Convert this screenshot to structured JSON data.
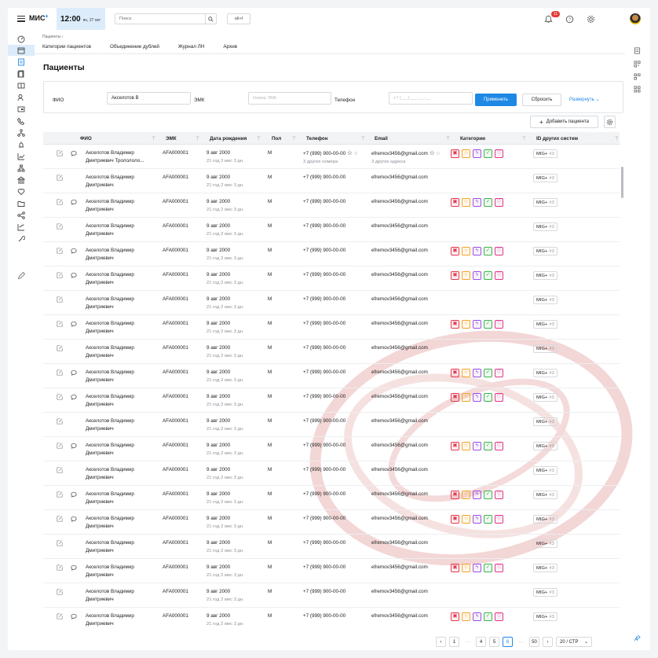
{
  "app": {
    "logo": "МИС",
    "logo_plus": "+",
    "time": "12:00",
    "date": "пн, 27 окт",
    "search_placeholder": "Поиск",
    "hotkey": "alt+f",
    "notifications_count": "11"
  },
  "breadcrumb": "Пациенты  ›",
  "tabs": [
    "Категории пациентов",
    "Объединение дублей",
    "Журнал ЛН",
    "Архив"
  ],
  "page_title": "Пациенты",
  "filters": {
    "fio_label": "ФИО",
    "fio_value": "Акселотов В",
    "emk_label": "ЭМК",
    "emk_placeholder": "Номер ЭМК",
    "phone_label": "Телефон",
    "phone_placeholder": "+7 (___) ___-__-__",
    "apply": "Применить",
    "reset": "Сбросить",
    "expand": "Развернуть"
  },
  "add_patient": "Добавить пациента",
  "columns": [
    "ФИО",
    "ЭМК",
    "Дата рождения",
    "Пол",
    "Телефон",
    "Email",
    "Категории",
    "ID других систем"
  ],
  "rows": [
    {
      "chat": true,
      "name1": "Акселотов Владимир",
      "name2": "Дмитриевич Тролололо...",
      "emk": "AFA000001",
      "dob": "9 авг 2000",
      "age": "21 год 2 мес 3 дн.",
      "sex": "М",
      "phone": "+7 (999) 900-00-00",
      "phone_sub": "3 других номера",
      "email": "efremov3456@gmail.com",
      "email_sub": "3 других адреса",
      "extra_icons": true,
      "cats": true,
      "mig": "MIG+",
      "mig_n": "#3"
    },
    {
      "chat": false,
      "name1": "Акселотов Владимир",
      "name2": "Дмитриевич",
      "emk": "AFA000001",
      "dob": "9 авг 2000",
      "age": "21 год 2 мес 3 дн.",
      "sex": "М",
      "phone": "+7 (999) 900-00-00",
      "phone_sub": "",
      "email": "efremov3456@gmail.com",
      "email_sub": "",
      "extra_icons": false,
      "cats": false,
      "mig": "MIG+",
      "mig_n": "#3"
    },
    {
      "chat": true,
      "name1": "Акселотов Владимир",
      "name2": "Дмитриевич",
      "emk": "AFA000001",
      "dob": "9 авг 2000",
      "age": "21 год 2 мес 3 дн.",
      "sex": "М",
      "phone": "+7 (999) 900-00-00",
      "phone_sub": "",
      "email": "efremov3456@gmail.com",
      "email_sub": "",
      "extra_icons": false,
      "cats": true,
      "mig": "MIG+",
      "mig_n": "#3"
    },
    {
      "chat": false,
      "name1": "Акселотов Владимир",
      "name2": "Дмитриевич",
      "emk": "AFA000001",
      "dob": "9 авг 2000",
      "age": "21 год 2 мес 3 дн.",
      "sex": "М",
      "phone": "+7 (999) 900-00-00",
      "phone_sub": "",
      "email": "efremov3456@gmail.com",
      "email_sub": "",
      "extra_icons": false,
      "cats": false,
      "mig": "MIG+",
      "mig_n": "#3"
    },
    {
      "chat": true,
      "name1": "Акселотов Владимир",
      "name2": "Дмитриевич",
      "emk": "AFA000001",
      "dob": "9 авг 2000",
      "age": "21 год 2 мес 3 дн.",
      "sex": "М",
      "phone": "+7 (999) 900-00-00",
      "phone_sub": "",
      "email": "efremov3456@gmail.com",
      "email_sub": "",
      "extra_icons": false,
      "cats": true,
      "mig": "MIG+",
      "mig_n": "#3"
    },
    {
      "chat": true,
      "name1": "Акселотов Владимир",
      "name2": "Дмитриевич",
      "emk": "AFA000001",
      "dob": "9 авг 2000",
      "age": "21 год 2 мес 3 дн.",
      "sex": "М",
      "phone": "+7 (999) 900-00-00",
      "phone_sub": "",
      "email": "efremov3456@gmail.com",
      "email_sub": "",
      "extra_icons": false,
      "cats": true,
      "mig": "MIG+",
      "mig_n": "#3"
    },
    {
      "chat": false,
      "name1": "Акселотов Владимир",
      "name2": "Дмитриевич",
      "emk": "AFA000001",
      "dob": "9 авг 2000",
      "age": "21 год 2 мес 3 дн.",
      "sex": "М",
      "phone": "+7 (999) 900-00-00",
      "phone_sub": "",
      "email": "efremov3456@gmail.com",
      "email_sub": "",
      "extra_icons": false,
      "cats": false,
      "mig": "MIG+",
      "mig_n": "#3"
    },
    {
      "chat": true,
      "name1": "Акселотов Владимир",
      "name2": "Дмитриевич",
      "emk": "AFA000001",
      "dob": "9 авг 2000",
      "age": "21 год 2 мес 3 дн.",
      "sex": "М",
      "phone": "+7 (999) 900-00-00",
      "phone_sub": "",
      "email": "efremov3456@gmail.com",
      "email_sub": "",
      "extra_icons": false,
      "cats": true,
      "mig": "MIG+",
      "mig_n": "#3"
    },
    {
      "chat": false,
      "name1": "Акселотов Владимир",
      "name2": "Дмитриевич",
      "emk": "AFA000001",
      "dob": "9 авг 2000",
      "age": "21 год 2 мес 3 дн.",
      "sex": "М",
      "phone": "+7 (999) 900-00-00",
      "phone_sub": "",
      "email": "efremov3456@gmail.com",
      "email_sub": "",
      "extra_icons": false,
      "cats": false,
      "mig": "MIG+",
      "mig_n": "#3"
    },
    {
      "chat": true,
      "name1": "Акселотов Владимир",
      "name2": "Дмитриевич",
      "emk": "AFA000001",
      "dob": "9 авг 2000",
      "age": "21 год 2 мес 3 дн.",
      "sex": "М",
      "phone": "+7 (999) 900-00-00",
      "phone_sub": "",
      "email": "efremov3456@gmail.com",
      "email_sub": "",
      "extra_icons": false,
      "cats": true,
      "mig": "MIG+",
      "mig_n": "#3"
    },
    {
      "chat": true,
      "name1": "Акселотов Владимир",
      "name2": "Дмитриевич",
      "emk": "AFA000001",
      "dob": "9 авг 2000",
      "age": "21 год 2 мес 3 дн.",
      "sex": "М",
      "phone": "+7 (999) 900-00-00",
      "phone_sub": "",
      "email": "efremov3456@gmail.com",
      "email_sub": "",
      "extra_icons": false,
      "cats": true,
      "mig": "MIG+",
      "mig_n": "#3"
    },
    {
      "chat": false,
      "name1": "Акселотов Владимир",
      "name2": "Дмитриевич",
      "emk": "AFA000001",
      "dob": "9 авг 2000",
      "age": "21 год 2 мес 3 дн.",
      "sex": "М",
      "phone": "+7 (999) 900-00-00",
      "phone_sub": "",
      "email": "efremov3456@gmail.com",
      "email_sub": "",
      "extra_icons": false,
      "cats": false,
      "mig": "MIG+",
      "mig_n": "#3"
    },
    {
      "chat": true,
      "name1": "Акселотов Владимир",
      "name2": "Дмитриевич",
      "emk": "AFA000001",
      "dob": "9 авг 2000",
      "age": "21 год 2 мес 3 дн.",
      "sex": "М",
      "phone": "+7 (999) 900-00-00",
      "phone_sub": "",
      "email": "efremov3456@gmail.com",
      "email_sub": "",
      "extra_icons": false,
      "cats": true,
      "mig": "MIG+",
      "mig_n": "#3"
    },
    {
      "chat": false,
      "name1": "Акселотов Владимир",
      "name2": "Дмитриевич",
      "emk": "AFA000001",
      "dob": "9 авг 2000",
      "age": "21 год 2 мес 3 дн.",
      "sex": "М",
      "phone": "+7 (999) 900-00-00",
      "phone_sub": "",
      "email": "efremov3456@gmail.com",
      "email_sub": "",
      "extra_icons": false,
      "cats": false,
      "mig": "MIG+",
      "mig_n": "#3"
    },
    {
      "chat": true,
      "name1": "Акселотов Владимир",
      "name2": "Дмитриевич",
      "emk": "AFA000001",
      "dob": "9 авг 2000",
      "age": "21 год 2 мес 3 дн.",
      "sex": "М",
      "phone": "+7 (999) 900-00-00",
      "phone_sub": "",
      "email": "efremov3456@gmail.com",
      "email_sub": "",
      "extra_icons": false,
      "cats": true,
      "mig": "MIG+",
      "mig_n": "#3"
    },
    {
      "chat": true,
      "name1": "Акселотов Владимир",
      "name2": "Дмитриевич",
      "emk": "AFA000001",
      "dob": "9 авг 2000",
      "age": "21 год 2 мес 3 дн.",
      "sex": "М",
      "phone": "+7 (999) 900-00-00",
      "phone_sub": "",
      "email": "efremov3456@gmail.com",
      "email_sub": "",
      "extra_icons": false,
      "cats": true,
      "mig": "MIG+",
      "mig_n": "#3"
    },
    {
      "chat": false,
      "name1": "Акселотов Владимир",
      "name2": "Дмитриевич",
      "emk": "AFA000001",
      "dob": "9 авг 2000",
      "age": "21 год 2 мес 3 дн.",
      "sex": "М",
      "phone": "+7 (999) 900-00-00",
      "phone_sub": "",
      "email": "efremov3456@gmail.com",
      "email_sub": "",
      "extra_icons": false,
      "cats": false,
      "mig": "MIG+",
      "mig_n": "#3"
    },
    {
      "chat": true,
      "name1": "Акселотов Владимир",
      "name2": "Дмитриевич",
      "emk": "AFA000001",
      "dob": "9 авг 2000",
      "age": "21 год 2 мес 3 дн.",
      "sex": "М",
      "phone": "+7 (999) 900-00-00",
      "phone_sub": "",
      "email": "efremov3456@gmail.com",
      "email_sub": "",
      "extra_icons": false,
      "cats": true,
      "mig": "MIG+",
      "mig_n": "#3"
    },
    {
      "chat": false,
      "name1": "Акселотов Владимир",
      "name2": "Дмитриевич",
      "emk": "AFA000001",
      "dob": "9 авг 2000",
      "age": "21 год 2 мес 3 дн.",
      "sex": "М",
      "phone": "+7 (999) 900-00-00",
      "phone_sub": "",
      "email": "efremov3456@gmail.com",
      "email_sub": "",
      "extra_icons": false,
      "cats": false,
      "mig": "MIG+",
      "mig_n": "#3"
    },
    {
      "chat": true,
      "name1": "Акселотов Владимир",
      "name2": "Дмитриевич",
      "emk": "AFA000001",
      "dob": "9 авг 2000",
      "age": "21 год 2 мес 3 дн.",
      "sex": "М",
      "phone": "+7 (999) 900-00-00",
      "phone_sub": "",
      "email": "efremov3456@gmail.com",
      "email_sub": "",
      "extra_icons": false,
      "cats": true,
      "mig": "MIG+",
      "mig_n": "#3"
    }
  ],
  "category_icons": [
    {
      "name": "card-icon",
      "glyph": "▣",
      "color": "#e53950"
    },
    {
      "name": "star-icon",
      "glyph": "☆",
      "color": "#f5a623"
    },
    {
      "name": "lightning-icon",
      "glyph": "ϟ",
      "color": "#9b51e0"
    },
    {
      "name": "check-icon",
      "glyph": "✓",
      "color": "#3bb54a"
    },
    {
      "name": "trophy-icon",
      "glyph": "♡",
      "color": "#e0398c"
    }
  ],
  "pager": {
    "pages": [
      "1",
      "···",
      "4",
      "5",
      "6",
      "···",
      "50"
    ],
    "active": "6",
    "page_size": "20 / СТР"
  },
  "colors": {
    "accent": "#1e88e5",
    "active_nav_bg": "#dcecfb"
  }
}
